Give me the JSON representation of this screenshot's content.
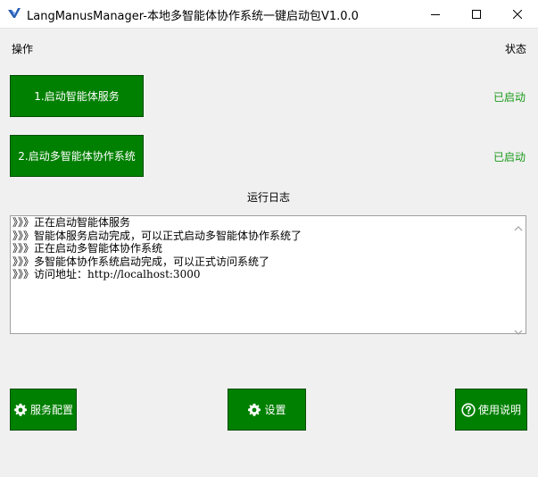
{
  "window": {
    "title": "LangManusManager-本地多智能体协作系统一键启动包V1.0.0"
  },
  "labels": {
    "operations": "操作",
    "status": "状态",
    "log_title": "运行日志"
  },
  "actions": [
    {
      "label": "1.启动智能体服务",
      "status": "已启动"
    },
    {
      "label": "2.启动多智能体协作系统",
      "status": "已启动"
    }
  ],
  "log": {
    "lines": [
      "》》》正在启动智能体服务",
      "》》》智能体服务启动完成，可以正式启动多智能体协作系统了",
      "》》》正在启动多智能体协作系统",
      "》》》多智能体协作系统启动完成，可以正式访问系统了",
      "》》》访问地址：http://localhost:3000"
    ]
  },
  "bottom_buttons": {
    "service_config": "服务配置",
    "settings": "设置",
    "help": "使用说明"
  },
  "colors": {
    "button_green": "#008000",
    "status_green": "#1a9a1a"
  },
  "icons": {
    "app": "app-logo-icon",
    "minimize": "minimize-icon",
    "maximize": "maximize-icon",
    "close": "close-icon",
    "service_config": "gear-icon",
    "settings": "gear-icon",
    "help": "question-circle-icon"
  }
}
